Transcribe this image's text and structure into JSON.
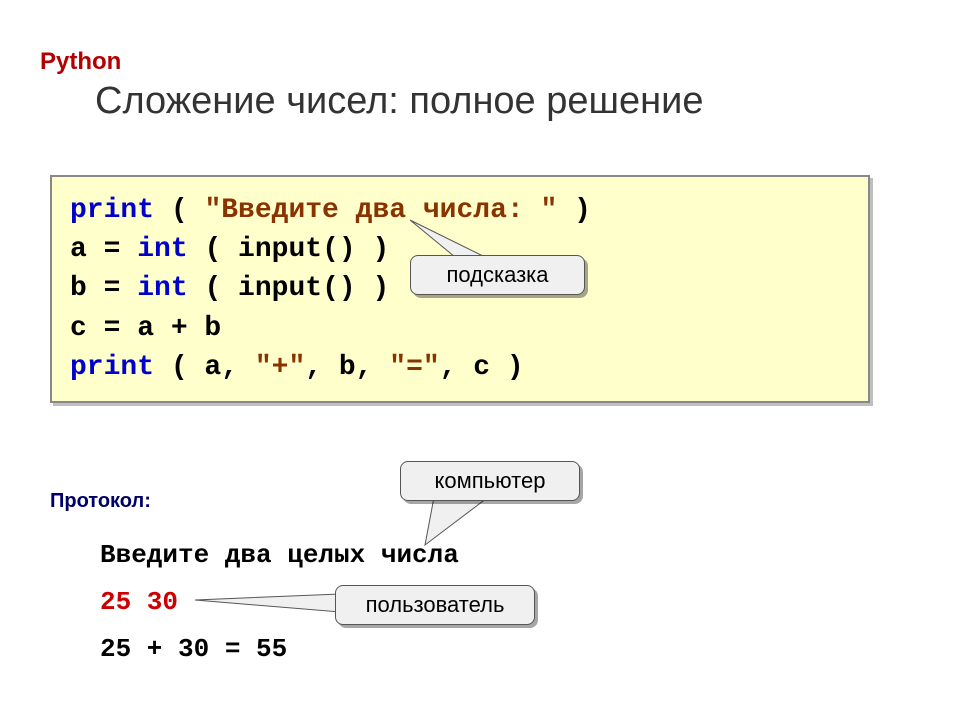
{
  "header": {
    "python": "Python",
    "title": "Сложение чисел: полное решение"
  },
  "code": {
    "line1_kw": "print",
    "line1_rest": " ( ",
    "line1_str": "\"Введите два числа: \"",
    "line1_close": " )",
    "line2_pre": "a = ",
    "line2_int": "int",
    "line2_in": " ( input() )",
    "line3_pre": "b = ",
    "line3_int": "int",
    "line3_in": " ( input() )",
    "line4": "c = a + b",
    "line5_kw": "print",
    "line5_p1": " ( a, ",
    "line5_q1": "\"+\"",
    "line5_p2": ", b, ",
    "line5_q2": "\"=\"",
    "line5_p3": ", c )"
  },
  "protocol": {
    "label": "Протокол:",
    "line1": "Введите два целых числа",
    "line2": "25 30",
    "line3": "25 + 30 = 55"
  },
  "callouts": {
    "hint": "подсказка",
    "computer": "компьютер",
    "user": "пользователь"
  }
}
